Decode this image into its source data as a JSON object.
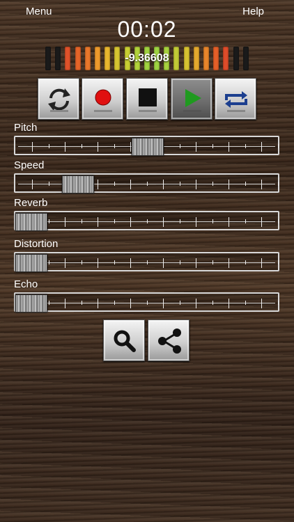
{
  "topbar": {
    "menu_label": "Menu",
    "help_label": "Help"
  },
  "timer": "00:02",
  "meter": {
    "readout": "-9.36608",
    "segments": 21,
    "lit_segments": 19
  },
  "transport": [
    {
      "name": "reset-button",
      "icon": "refresh-icon"
    },
    {
      "name": "record-button",
      "icon": "record-icon"
    },
    {
      "name": "stop-button",
      "icon": "stop-icon"
    },
    {
      "name": "play-button",
      "icon": "play-icon"
    },
    {
      "name": "loop-button",
      "icon": "loop-icon"
    }
  ],
  "params": [
    {
      "label": "Pitch",
      "value": 0.5
    },
    {
      "label": "Speed",
      "value": 0.2
    },
    {
      "label": "Reverb",
      "value": 0.0
    },
    {
      "label": "Distortion",
      "value": 0.0
    },
    {
      "label": "Echo",
      "value": 0.0
    }
  ],
  "actions": [
    {
      "name": "search-button",
      "icon": "search-icon"
    },
    {
      "name": "share-button",
      "icon": "share-icon"
    }
  ]
}
